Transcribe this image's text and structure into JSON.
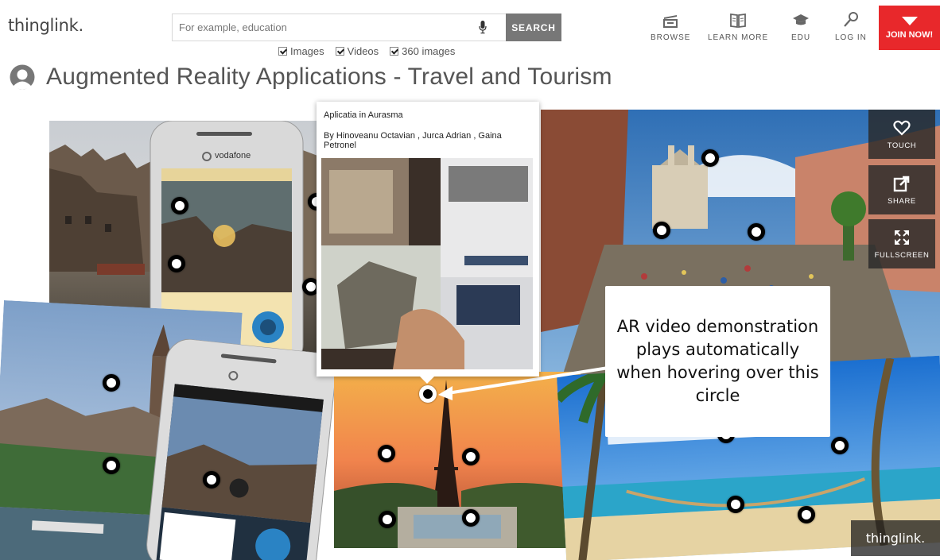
{
  "header": {
    "logo_text": "thinglink.",
    "search": {
      "placeholder": "For example, education",
      "button_label": "SEARCH"
    },
    "filters": [
      {
        "label": "Images",
        "checked": true
      },
      {
        "label": "Videos",
        "checked": true
      },
      {
        "label": "360 images",
        "checked": true
      }
    ],
    "nav": [
      {
        "label": "BROWSE",
        "icon": "browse-icon"
      },
      {
        "label": "LEARN MORE",
        "icon": "book-icon"
      },
      {
        "label": "EDU",
        "icon": "graduation-cap-icon"
      },
      {
        "label": "LOG IN",
        "icon": "key-icon"
      }
    ],
    "join_label": "JOIN NOW!",
    "colors": {
      "join_bg": "#e8282b",
      "search_btn_bg": "#777777"
    }
  },
  "page": {
    "title": "Augmented Reality Applications - Travel and Tourism"
  },
  "popup": {
    "title": "Aplicatia in Aurasma",
    "byline": "By Hinoveanu Octavian , Jurca Adrian , Gaina Petronel"
  },
  "callout": {
    "text": "AR video demonstration plays automatically when hovering over this circle"
  },
  "side_buttons": [
    {
      "label": "TOUCH",
      "icon": "heart-icon"
    },
    {
      "label": "SHARE",
      "icon": "share-icon"
    },
    {
      "label": "FULLSCREEN",
      "icon": "fullscreen-icon"
    }
  ],
  "watermark": "thinglink.",
  "phone_brand": "vodafone"
}
